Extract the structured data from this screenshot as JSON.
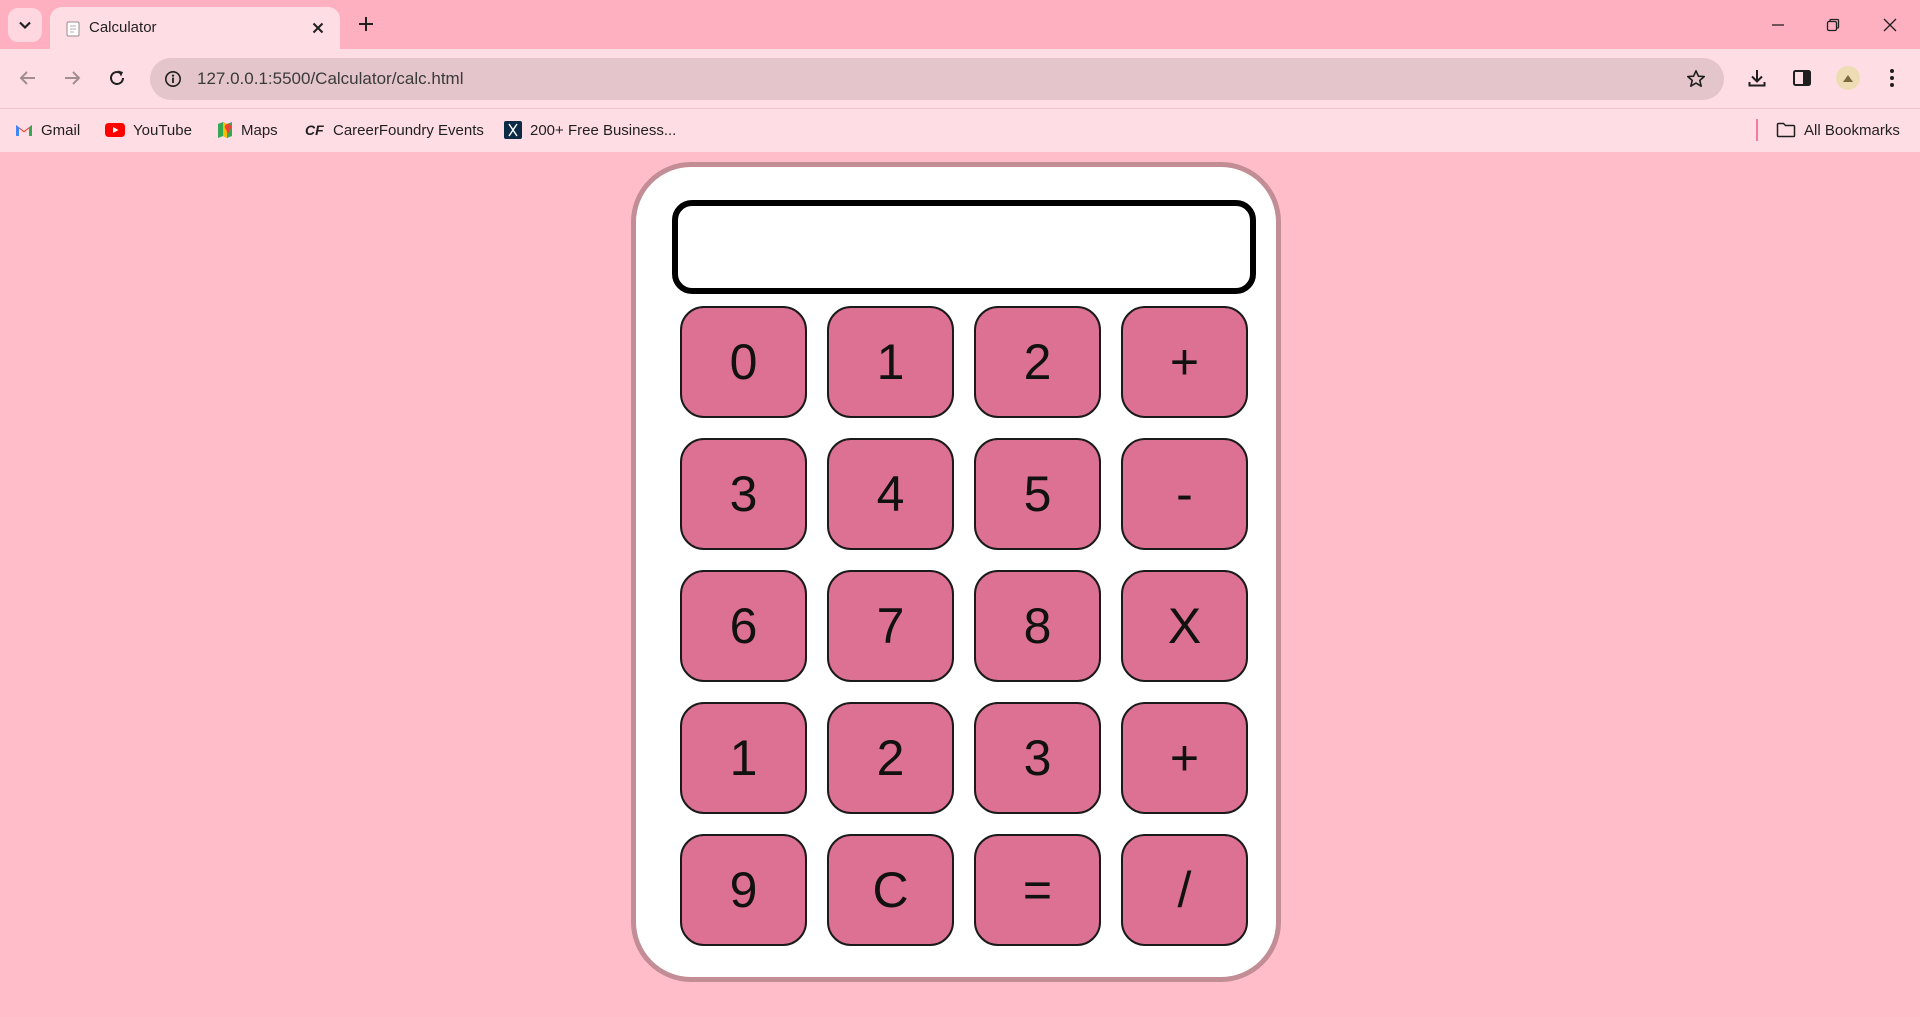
{
  "browser": {
    "tab_title": "Calculator",
    "url": "127.0.0.1:5500/Calculator/calc.html",
    "bookmarks": [
      {
        "label": "Gmail",
        "icon": "gmail-icon"
      },
      {
        "label": "YouTube",
        "icon": "youtube-icon"
      },
      {
        "label": "Maps",
        "icon": "maps-icon"
      },
      {
        "label": "CareerFoundry Events",
        "icon": "careerfoundry-icon"
      },
      {
        "label": "200+ Free Business...",
        "icon": "bookmark-site-icon"
      }
    ],
    "all_bookmarks": "All Bookmarks",
    "colors": {
      "tabstrip": "#ffb0c0",
      "toolbar": "#ffdde5",
      "omnibox": "#e4c5cb"
    }
  },
  "calculator": {
    "display_value": "",
    "keys": [
      [
        "0",
        "1",
        "2",
        "+"
      ],
      [
        "3",
        "4",
        "5",
        "-"
      ],
      [
        "6",
        "7",
        "8",
        "X"
      ],
      [
        "1",
        "2",
        "3",
        "+"
      ],
      [
        "9",
        "C",
        "=",
        "/"
      ]
    ],
    "colors": {
      "page_background": "#ffbdca",
      "body": "#ffffff",
      "body_border": "#c28d95",
      "key": "#dc7193"
    }
  }
}
